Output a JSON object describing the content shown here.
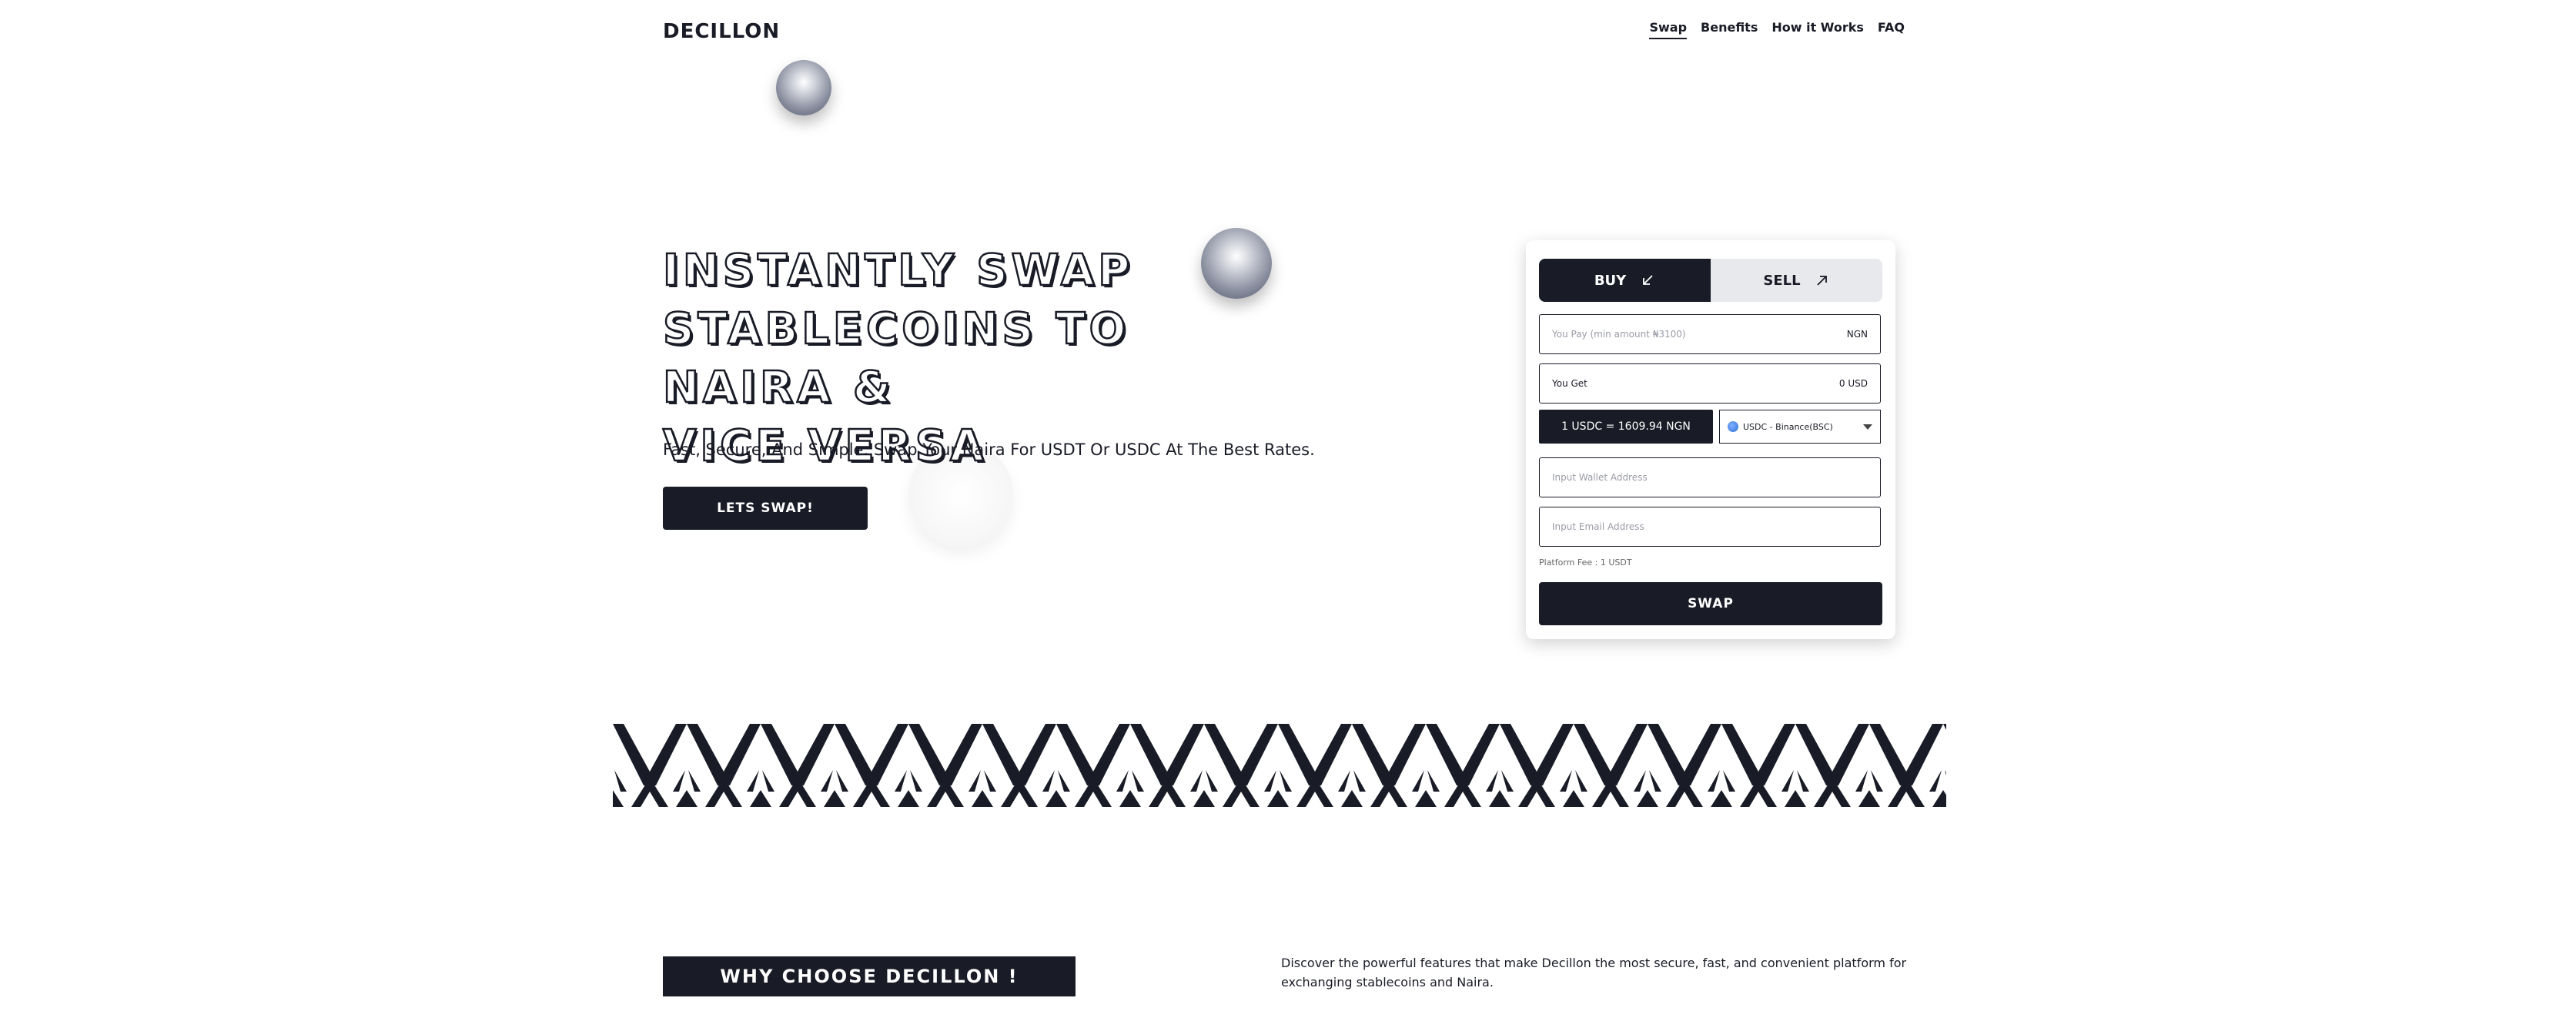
{
  "header": {
    "logo": "DECILLON",
    "nav": [
      "Swap",
      "Benefits",
      "How it Works",
      "FAQ"
    ],
    "active_nav": "Swap"
  },
  "hero": {
    "title_lines": [
      "INSTANTLY SWAP",
      "STABLECOINS TO NAIRA &",
      "VICE VERSA"
    ],
    "subtitle": "Fast, Secure, And Simple. Swap Your Naira For USDT Or USDC At The Best Rates.",
    "cta_label": "LETS SWAP!"
  },
  "swap_card": {
    "tabs": [
      {
        "label": "BUY",
        "icon": "arrow-down-left-icon",
        "active": true
      },
      {
        "label": "SELL",
        "icon": "arrow-up-right-icon",
        "active": false
      }
    ],
    "pay_field": {
      "placeholder": "You Pay  (min amount ₦3100)",
      "currency": "NGN"
    },
    "get_field": {
      "label": "You Get",
      "value": "0 USD"
    },
    "rate_text": "1 USDC = 1609.94 NGN",
    "network_select": {
      "selected": "USDC - Binance(BSC)",
      "icon": "globe-icon"
    },
    "wallet_placeholder": "Input Wallet Address",
    "email_placeholder": "Input Email Address",
    "fee_text": "Platform Fee : 1 USDT",
    "swap_label": "SWAP"
  },
  "why": {
    "heading": "WHY CHOOSE DECILLON !",
    "description": "Discover the powerful features that make Decillon the most secure, fast, and convenient platform for exchanging stablecoins and Naira."
  },
  "colors": {
    "primary": "#191b26",
    "background": "#ffffff",
    "muted": "#e8e9ec"
  }
}
